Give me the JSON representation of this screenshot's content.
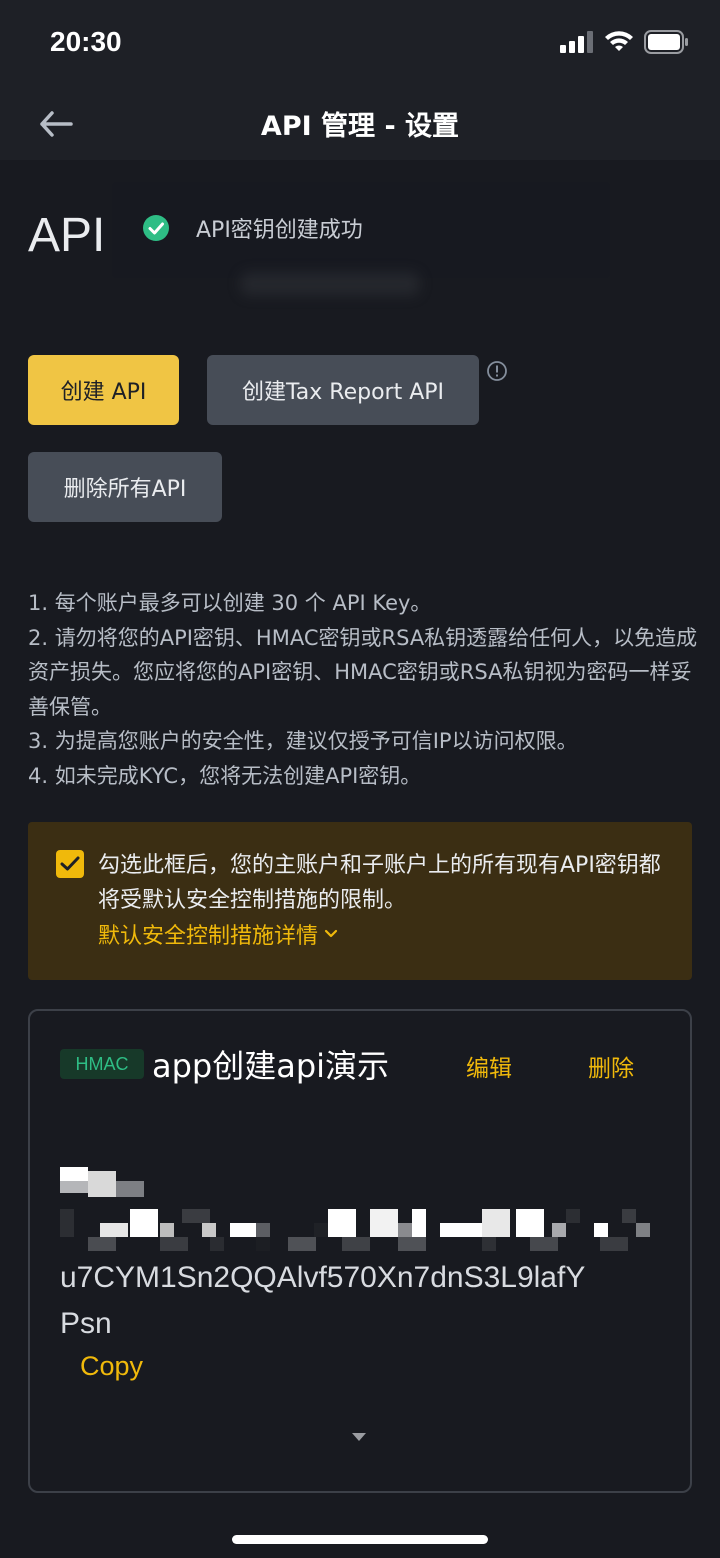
{
  "status_bar": {
    "time": "20:30"
  },
  "nav": {
    "title": "API 管理 - 设置",
    "back_icon": "arrow-left-icon"
  },
  "page": {
    "heading": "API"
  },
  "toast": {
    "message": "API密钥创建成功",
    "icon": "check-circle-icon",
    "color": "#2ebd85"
  },
  "buttons": {
    "create_api": "创建 API",
    "create_tax_api": "创建Tax Report API",
    "delete_all": "删除所有API"
  },
  "notes": [
    "1. 每个账户最多可以创建 30 个 API Key。",
    "2. 请勿将您的API密钥、HMAC密钥或RSA私钥透露给任何人，以免造成资产损失。您应将您的API密钥、HMAC密钥或RSA私钥视为密码一样妥善保管。",
    "3. 为提高您账户的安全性，建议仅授予可信IP以访问权限。",
    "4. 如未完成KYC，您将无法创建API密钥。"
  ],
  "warning": {
    "checked": true,
    "text": "勾选此框后，您的主账户和子账户上的所有现有API密钥都将受默认安全控制措施的限制。",
    "link": "默认安全控制措施详情"
  },
  "api_card": {
    "badge": "HMAC",
    "name": "app创建api演示",
    "edit": "编辑",
    "delete": "删除",
    "key_visible_line1": "u7CYM1Sn2QQAlvf570Xn7dnS3L9lafY",
    "key_visible_line2": "Psn",
    "copy": "Copy"
  },
  "colors": {
    "accent": "#f0b90b",
    "background": "#181a20",
    "success": "#2ebd85"
  }
}
